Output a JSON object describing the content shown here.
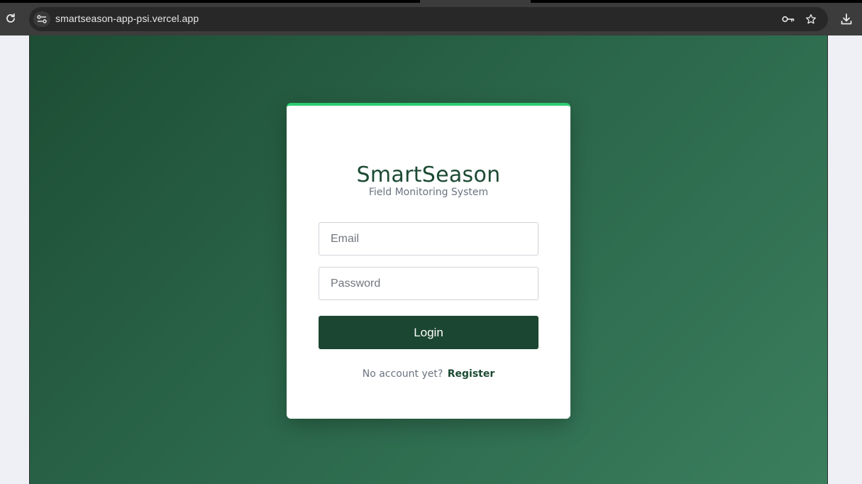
{
  "browser": {
    "url": "smartseason-app-psi.vercel.app"
  },
  "icons": {
    "reload": "reload-icon",
    "site_info": "tune-icon",
    "key": "key-icon",
    "star": "star-icon",
    "download": "download-icon"
  },
  "app": {
    "title": "SmartSeason",
    "subtitle": "Field Monitoring System"
  },
  "login_form": {
    "email_placeholder": "Email",
    "email_value": "",
    "password_placeholder": "Password",
    "password_value": "",
    "login_label": "Login",
    "no_account_text": "No account yet?",
    "register_label": "Register"
  },
  "colors": {
    "brand_dark_green": "#1b4631",
    "accent_green": "#2ecc71",
    "background_gradient_start": "#1d4d34",
    "background_gradient_end": "#3a7e5d"
  }
}
